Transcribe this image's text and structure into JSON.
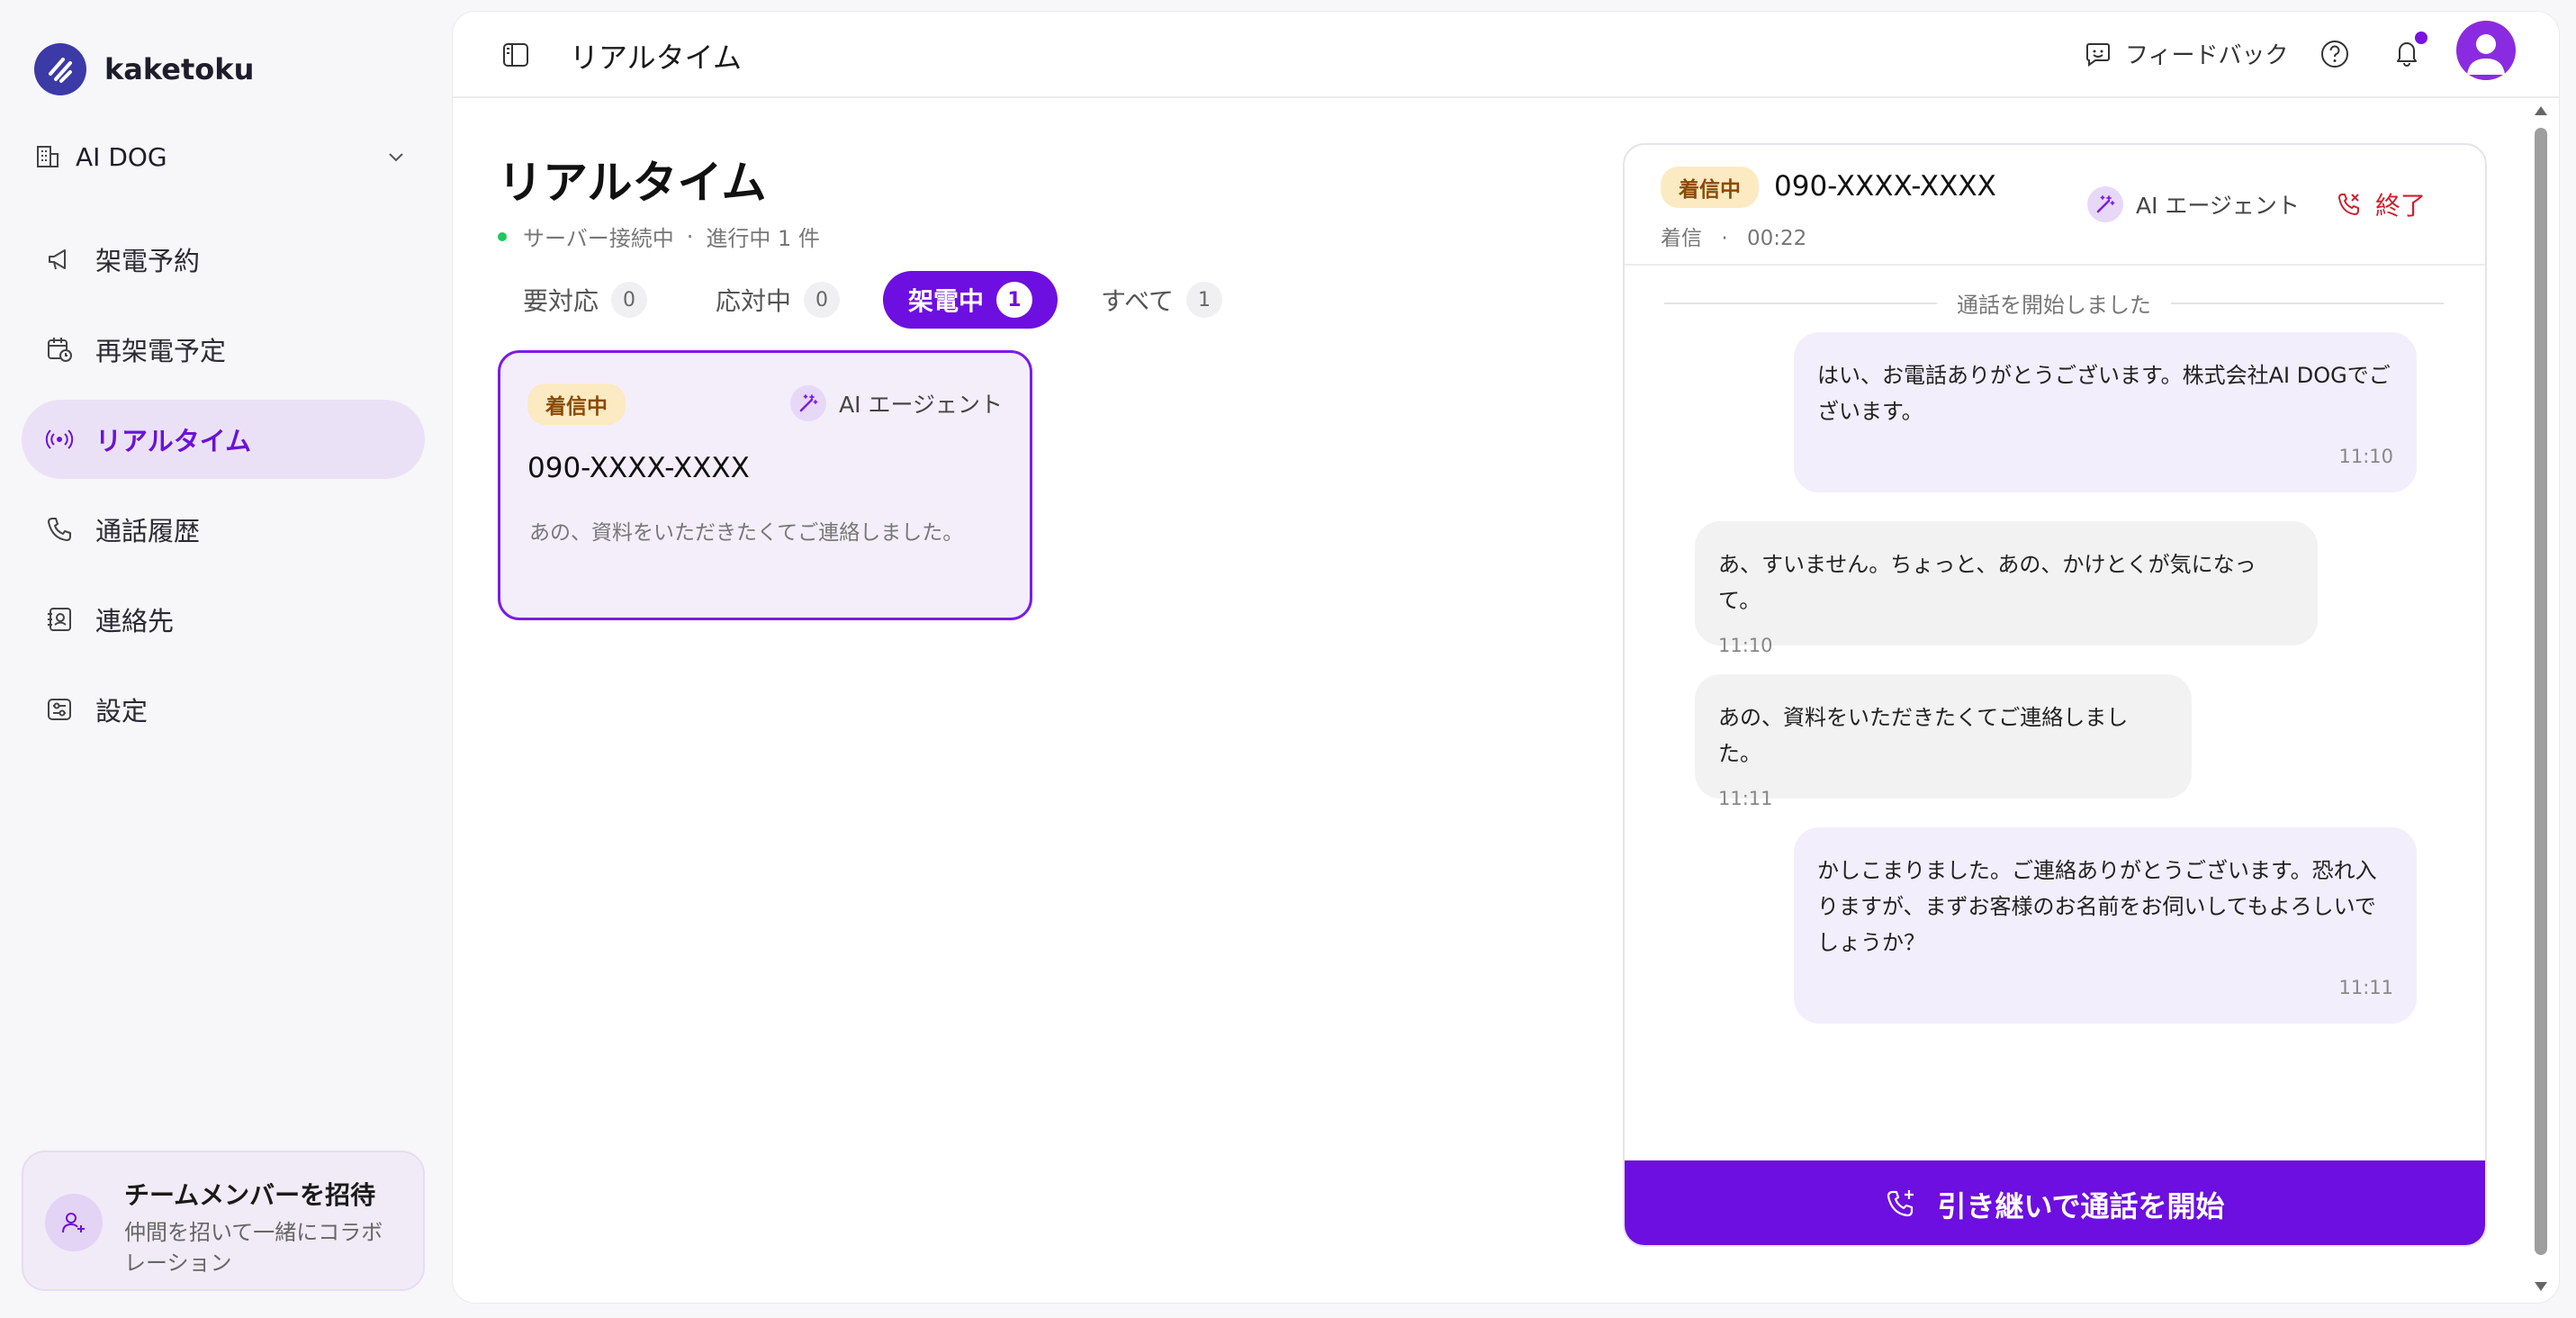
{
  "brand": {
    "name": "kaketoku"
  },
  "org": {
    "name": "AI DOG"
  },
  "sidebar": {
    "items": [
      {
        "label": "架電予約",
        "icon": "megaphone-icon"
      },
      {
        "label": "再架電予定",
        "icon": "calendar-clock-icon"
      },
      {
        "label": "リアルタイム",
        "icon": "broadcast-icon",
        "active": true
      },
      {
        "label": "通話履歴",
        "icon": "phone-icon"
      },
      {
        "label": "連絡先",
        "icon": "contacts-icon"
      },
      {
        "label": "設定",
        "icon": "settings-icon"
      }
    ],
    "invite": {
      "title": "チームメンバーを招待",
      "desc": "仲間を招いて一緒にコラボレーション"
    }
  },
  "header": {
    "title": "リアルタイム",
    "feedback": "フィードバック"
  },
  "page": {
    "title": "リアルタイム",
    "status": {
      "server": "サーバー接続中",
      "progress": "進行中 1 件"
    }
  },
  "tabs": [
    {
      "label": "要対応",
      "count": "0"
    },
    {
      "label": "応対中",
      "count": "0"
    },
    {
      "label": "架電中",
      "count": "1",
      "active": true
    },
    {
      "label": "すべて",
      "count": "1"
    }
  ],
  "card": {
    "badge": "着信中",
    "agent": "AI エージェント",
    "phone": "090-XXXX-XXXX",
    "snippet": "あの、資料をいただきたくてご連絡しました。"
  },
  "conversation": {
    "badge": "着信中",
    "phone": "090-XXXX-XXXX",
    "direction": "着信",
    "duration": "00:22",
    "agent": "AI エージェント",
    "end_label": "終了",
    "divider": "通話を開始しました",
    "messages": [
      {
        "role": "ai",
        "text": "はい、お電話ありがとうございます。株式会社AI DOGでございます。",
        "time": "11:10"
      },
      {
        "role": "user",
        "text": "あ、すいません。ちょっと、あの、かけとくが気になって。",
        "time": "11:10"
      },
      {
        "role": "user",
        "text": "あの、資料をいただきたくてご連絡しました。",
        "time": "11:11"
      },
      {
        "role": "ai",
        "text": "かしこまりました。ご連絡ありがとうございます。恐れ入りますが、まずお客様のお名前をお伺いしてもよろしいでしょうか？",
        "time": "11:11"
      }
    ],
    "handover_label": "引き継いで通話を開始"
  },
  "colors": {
    "accent": "#6d0fe0",
    "badge_bg": "#fbeac2",
    "end": "#d01f2e",
    "online": "#22c55e"
  }
}
